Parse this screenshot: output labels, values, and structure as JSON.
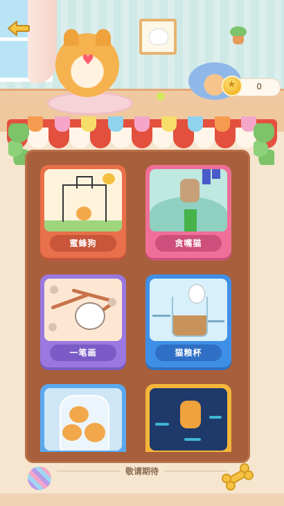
{
  "header": {
    "coin_count": "0"
  },
  "games": [
    {
      "label": "蜜蜂狗"
    },
    {
      "label": "贪嘴猫"
    },
    {
      "label": "一笔画"
    },
    {
      "label": "猫粮杯"
    }
  ],
  "footer": {
    "coming_soon": "敬请期待"
  },
  "icons": {
    "back": "back-arrow-icon",
    "coin": "star-coin-icon",
    "ball": "ball-icon",
    "bone": "bone-icon"
  },
  "colors": {
    "accent_red": "#e4503e",
    "board_brown": "#a85f3c",
    "card_orange": "#e8704a",
    "card_pink": "#ef6f98",
    "card_purple": "#9a78e0",
    "card_blue": "#3f8fe6"
  }
}
